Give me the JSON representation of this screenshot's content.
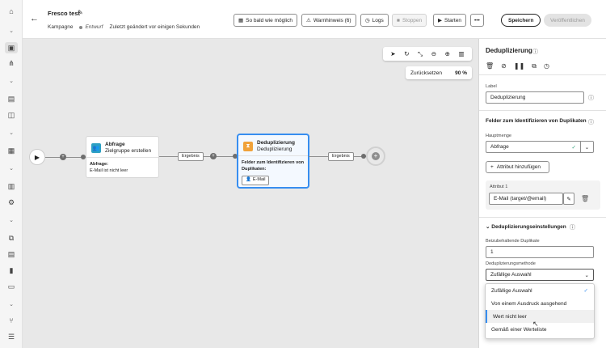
{
  "header": {
    "title": "Fresco test",
    "breadcrumb_campaign": "Kampagne",
    "status": "Entwurf",
    "last_modified": "Zuletzt geändert vor einigen Sekunden",
    "btn_asap": "So bald wie möglich",
    "btn_warnings": "Warnhinweis (6)",
    "btn_logs": "Logs",
    "btn_stop": "Stoppen",
    "btn_start": "Starten",
    "btn_save": "Speichern",
    "btn_publish": "Veröffentlichen"
  },
  "canvas": {
    "reset_label": "Zurücksetzen",
    "zoom": "90 %",
    "node1": {
      "title": "Abfrage",
      "subtitle": "Zielgruppe erstellen",
      "body_label": "Abfrage:",
      "body_value": "E-Mail ist nicht leer"
    },
    "node2": {
      "title": "Deduplizierung",
      "subtitle": "Deduplizierung",
      "body_label": "Felder zum Identifizieren von Duplikaten:",
      "chip": "E-Mail"
    },
    "edge1_label": "Ergebnis",
    "edge2_label": "Ergebnis"
  },
  "panel": {
    "title": "Deduplizierung",
    "label_caption": "Label",
    "label_value": "Deduplizierung",
    "section1": "Felder zum Identifizieren von Duplikaten",
    "hauptmenge_caption": "Hauptmenge",
    "hauptmenge_value": "Abfrage",
    "add_attribute": "Attribut hinzufügen",
    "attribute_caption": "Attribut 1",
    "attribute_value": "E-Mail (target/@email)",
    "section2": "Deduplizierungseinstellungen",
    "duplicates_caption": "Beizubehaltende Duplikate",
    "duplicates_value": "1",
    "method_caption": "Deduplizierungsmethode",
    "method_value": "Zufällige Auswahl"
  },
  "dropdown": {
    "options": [
      "Zufällige Auswahl",
      "Von einem Ausdruck ausgehend",
      "Wert nicht leer",
      "Gemäß einer Werteliste"
    ],
    "selected": "Zufällige Auswahl",
    "hovered": "Wert nicht leer"
  }
}
